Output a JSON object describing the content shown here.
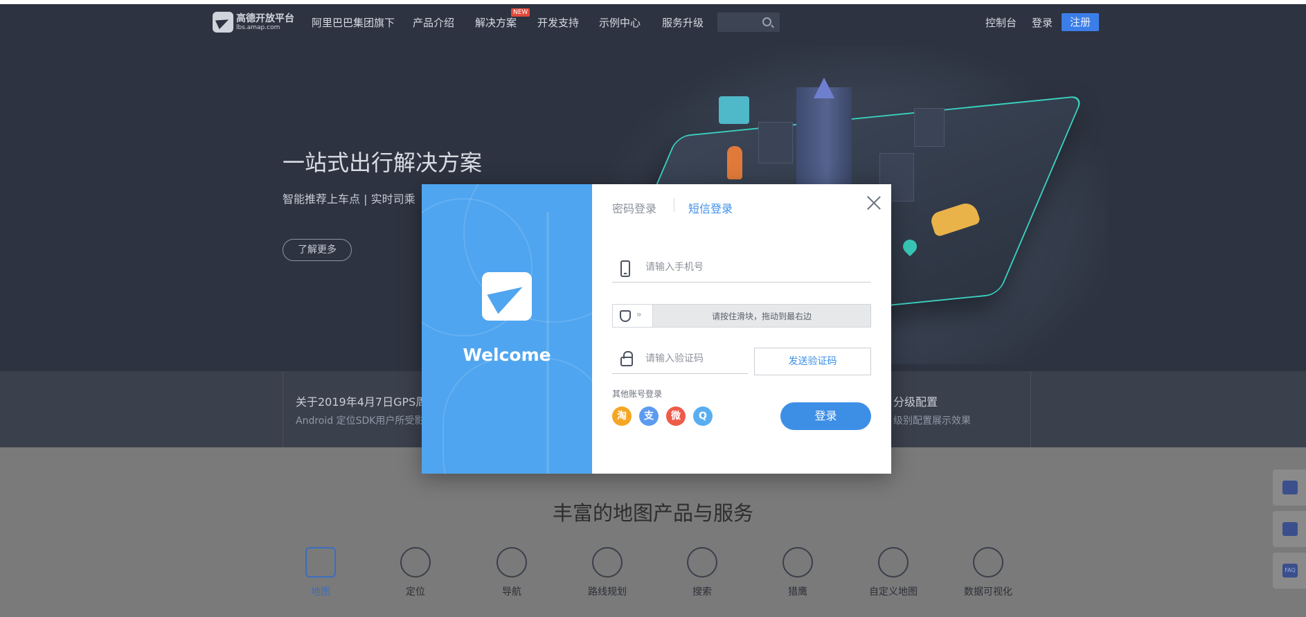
{
  "nav": {
    "logo_cn": "高德开放平台",
    "logo_en": "lbs.amap.com",
    "items": [
      "阿里巴巴集团旗下",
      "产品介绍",
      "解决方案",
      "开发支持",
      "示例中心",
      "服务升级"
    ],
    "new_badge": "NEW",
    "console": "控制台",
    "login": "登录",
    "register": "注册"
  },
  "hero": {
    "title": "一站式出行解决方案",
    "subtitle": "智能推荐上车点 | 实时司乘",
    "button": "了解更多"
  },
  "news": [
    {
      "title": "关于2019年4月7日GPS周",
      "desc": "Android 定位SDK用户所受影"
    },
    {
      "title": "分级配置",
      "desc": "级别配置展示效果"
    }
  ],
  "products": {
    "title": "丰富的地图产品与服务",
    "items": [
      "地图",
      "定位",
      "导航",
      "路线规划",
      "搜索",
      "猎鹰",
      "自定义地图",
      "数据可视化"
    ]
  },
  "side_float": {
    "faq": "FAQ"
  },
  "modal": {
    "welcome": "Welcome",
    "tab_password": "密码登录",
    "tab_sms": "短信登录",
    "phone_placeholder": "请输入手机号",
    "slider_text": "请按住滑块，拖动到最右边",
    "code_placeholder": "请输入验证码",
    "send_code": "发送验证码",
    "other_login": "其他账号登录",
    "social": [
      {
        "glyph": "淘",
        "color": "#f5a623"
      },
      {
        "glyph": "支",
        "color": "#5d9bf0"
      },
      {
        "glyph": "微",
        "color": "#ee5b4a"
      },
      {
        "glyph": "Q",
        "color": "#5aaef0"
      }
    ],
    "login_button": "登录"
  }
}
